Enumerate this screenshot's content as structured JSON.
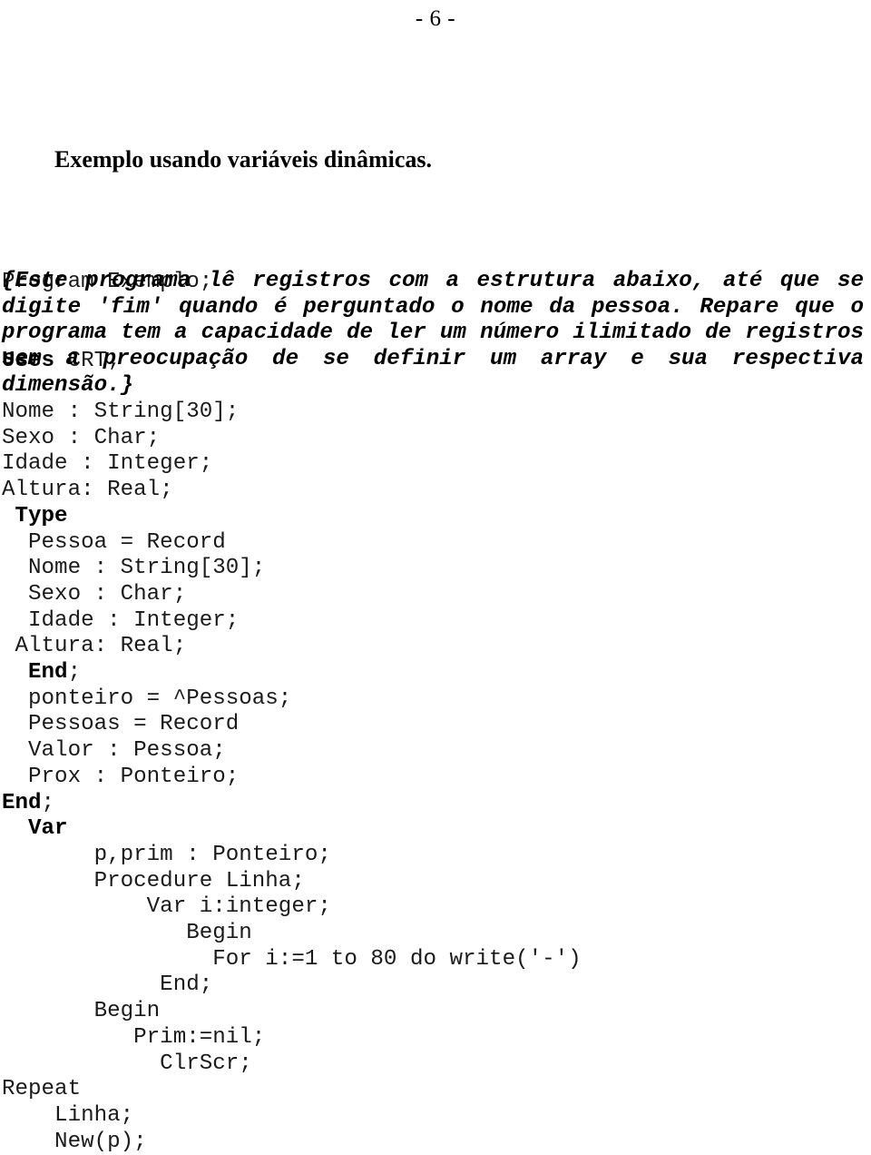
{
  "page": {
    "page_number_label": "- 6 -",
    "title": "Exemplo usando variáveis dinâmicas."
  },
  "code_head": {
    "line1_text": "Program Exemplo;",
    "line2_keyword": "Uses",
    "line2_rest": " CRT;"
  },
  "comment_block": {
    "text": "{Este programa lê registros com a estrutura abaixo, até que se digite 'fim' quando é perguntado o nome da pessoa. Repare que o programa tem a capacidade de ler um número ilimitado de registros sem a preocupação de se definir um array e sua respectiva dimensão.}"
  },
  "code_body": {
    "lines": [
      {
        "indent": 0,
        "text": "Nome : String[30];",
        "bold_prefix": ""
      },
      {
        "indent": 0,
        "text": "Sexo : Char;",
        "bold_prefix": ""
      },
      {
        "indent": 0,
        "text": "Idade : Integer;",
        "bold_prefix": ""
      },
      {
        "indent": 0,
        "text": "Altura: Real;",
        "bold_prefix": ""
      },
      {
        "indent": 1,
        "text": "",
        "bold_prefix": "Type"
      },
      {
        "indent": 2,
        "text": "Pessoa = Record",
        "bold_prefix": ""
      },
      {
        "indent": 2,
        "text": "Nome : String[30];",
        "bold_prefix": ""
      },
      {
        "indent": 2,
        "text": "Sexo : Char;",
        "bold_prefix": ""
      },
      {
        "indent": 2,
        "text": "Idade : Integer;",
        "bold_prefix": ""
      },
      {
        "indent": 1,
        "text": "Altura: Real;",
        "bold_prefix": ""
      },
      {
        "indent": 2,
        "text": ";",
        "bold_prefix": "End"
      },
      {
        "indent": 2,
        "text": "ponteiro = ^Pessoas;",
        "bold_prefix": ""
      },
      {
        "indent": 2,
        "text": "Pessoas = Record",
        "bold_prefix": ""
      },
      {
        "indent": 2,
        "text": "Valor : Pessoa;",
        "bold_prefix": ""
      },
      {
        "indent": 2,
        "text": "Prox : Ponteiro;",
        "bold_prefix": ""
      },
      {
        "indent": 0,
        "text": ";",
        "bold_prefix": "End"
      },
      {
        "indent": 2,
        "text": "",
        "bold_prefix": "Var"
      },
      {
        "indent": 7,
        "text": "p,prim : Ponteiro;",
        "bold_prefix": ""
      },
      {
        "indent": 7,
        "text": "Procedure Linha;",
        "bold_prefix": ""
      },
      {
        "indent": 11,
        "text": "Var i:integer;",
        "bold_prefix": ""
      },
      {
        "indent": 14,
        "text": "Begin",
        "bold_prefix": ""
      },
      {
        "indent": 16,
        "text": "For i:=1 to 80 do write('-')",
        "bold_prefix": ""
      },
      {
        "indent": 12,
        "text": "End;",
        "bold_prefix": ""
      },
      {
        "indent": 7,
        "text": "Begin",
        "bold_prefix": ""
      },
      {
        "indent": 10,
        "text": "Prim:=nil;",
        "bold_prefix": ""
      },
      {
        "indent": 12,
        "text": "ClrScr;",
        "bold_prefix": ""
      },
      {
        "indent": 0,
        "text": "Repeat",
        "bold_prefix": ""
      },
      {
        "indent": 4,
        "text": "Linha;",
        "bold_prefix": ""
      },
      {
        "indent": 4,
        "text": "New(p);",
        "bold_prefix": ""
      }
    ]
  }
}
